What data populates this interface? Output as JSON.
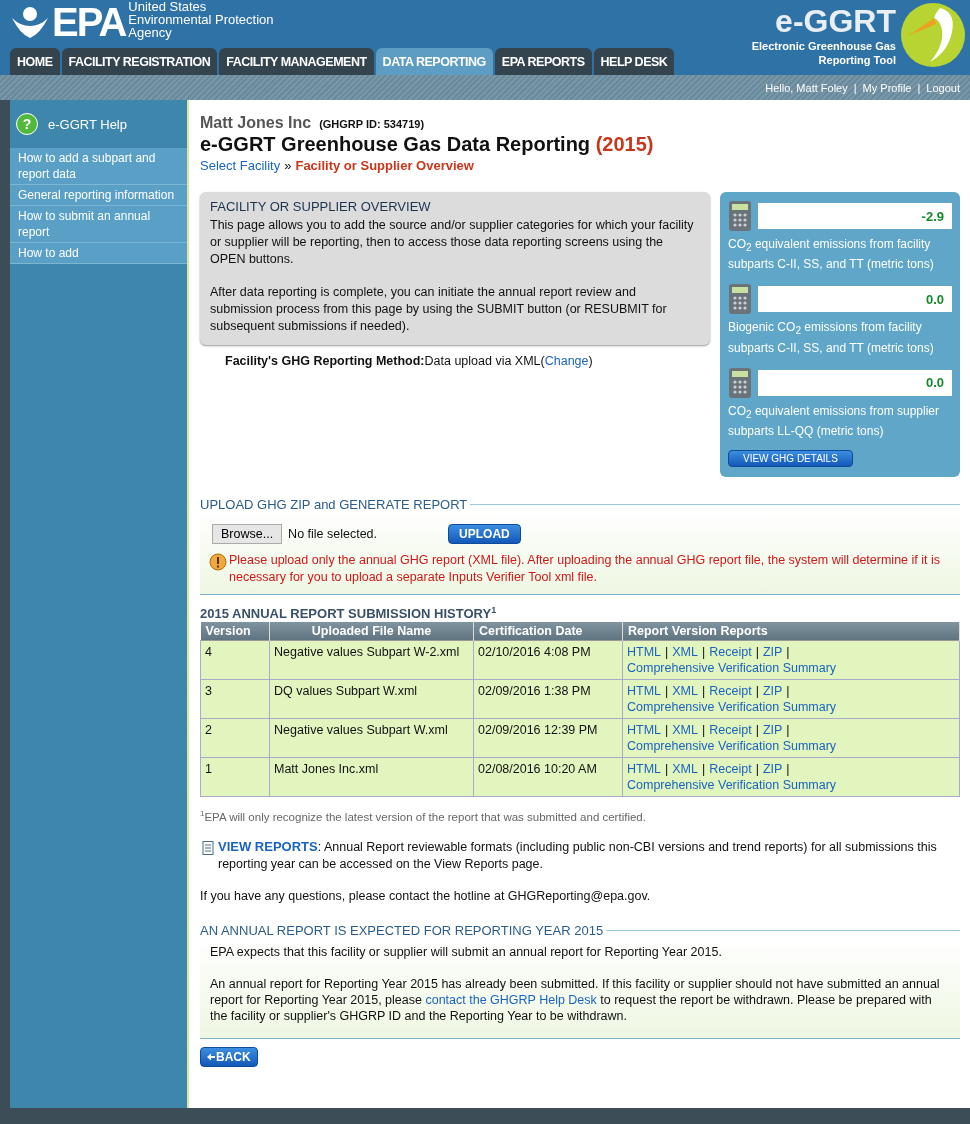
{
  "header": {
    "logo_text": "EPA",
    "agency_lines": [
      "United States",
      "Environmental Protection",
      "Agency"
    ],
    "app_logo": "e-GGRT",
    "app_subtitle_lines": [
      "Electronic Greenhouse Gas",
      "Reporting Tool"
    ]
  },
  "tabs": [
    {
      "label": "HOME",
      "selected": false
    },
    {
      "label": "FACILITY REGISTRATION",
      "selected": false
    },
    {
      "label": "FACILITY MANAGEMENT",
      "selected": false
    },
    {
      "label": "DATA REPORTING",
      "selected": true
    },
    {
      "label": "EPA REPORTS",
      "selected": false
    },
    {
      "label": "HELP DESK",
      "selected": false
    }
  ],
  "user_bar": {
    "greeting": "Hello, Matt Foley",
    "links": [
      "My Profile",
      "Logout"
    ],
    "separator": "|"
  },
  "sidebar": {
    "icon_glyph": "?",
    "title": "e-GGRT Help",
    "items": [
      "How to add a subpart and report data",
      "General reporting information",
      "How to submit an annual report",
      "How to add"
    ]
  },
  "page": {
    "company": "Matt Jones Inc",
    "ghgrp_id": "(GHGRP ID: 534719)",
    "title": "e-GGRT Greenhouse Gas Data Reporting",
    "year": "(2015)",
    "breadcrumb": {
      "link": "Select Facility",
      "separator": "»",
      "current": "Facility or Supplier Overview"
    }
  },
  "overview": {
    "heading": "FACILITY OR SUPPLIER OVERVIEW",
    "paragraphs": [
      "This page allows you to add the source and/or supplier categories for which your facility or supplier will be reporting, then to access those data reporting screens using the OPEN buttons.",
      "After data reporting is complete, you can initiate the annual report review and submission process from this page by using the SUBMIT button (or RESUBMIT for subsequent submissions if needed)."
    ]
  },
  "method": {
    "label": "Facility's GHG Reporting Method:",
    "value": "Data upload via XML",
    "open": "(",
    "link": "Change",
    "close": ")"
  },
  "emissions": {
    "items": [
      {
        "value": "-2.9",
        "label": "CO$_{2}$ equivalent emissions from facility subparts C-II, SS, and TT (metric tons)"
      },
      {
        "value": "0.0",
        "label": "Biogenic CO$_{2}$ emissions from facility subparts C-II, SS, and TT (metric tons)"
      },
      {
        "value": "0.0",
        "label": "CO$_{2}$ equivalent emissions from supplier subparts LL-QQ (metric tons)"
      }
    ],
    "button": "VIEW GHG DETAILS"
  },
  "upload": {
    "heading": "UPLOAD GHG ZIP and GENERATE REPORT",
    "browse": "Browse...",
    "file_status": "No file selected.",
    "button": "UPLOAD",
    "warning": "Please upload only the annual GHG report (XML file). After uploading the annual GHG report file, the system will determine if it is necessary for you to upload a separate Inputs Verifier Tool xml file."
  },
  "history": {
    "title": "2015 ANNUAL REPORT SUBMISSION HISTORY$^{1}$",
    "columns": [
      "Version",
      "Uploaded File Name",
      "Certification Date",
      "Report Version Reports"
    ],
    "separator": "|",
    "rows": [
      {
        "version": "4",
        "file": "Negative values Subpart W-2.xml",
        "date": "02/10/2016 4:08 PM",
        "links": [
          "HTML",
          "XML",
          "Receipt",
          "ZIP",
          "Comprehensive Verification Summary"
        ]
      },
      {
        "version": "3",
        "file": "DQ values Subpart W.xml",
        "date": "02/09/2016 1:38 PM",
        "links": [
          "HTML",
          "XML",
          "Receipt",
          "ZIP",
          "Comprehensive Verification Summary"
        ]
      },
      {
        "version": "2",
        "file": "Negative values Subpart W.xml",
        "date": "02/09/2016 12:39 PM",
        "links": [
          "HTML",
          "XML",
          "Receipt",
          "ZIP",
          "Comprehensive Verification Summary"
        ]
      },
      {
        "version": "1",
        "file": "Matt Jones Inc.xml",
        "date": "02/08/2016 10:20 AM",
        "links": [
          "HTML",
          "XML",
          "Receipt",
          "ZIP",
          "Comprehensive Verification Summary"
        ]
      }
    ],
    "footnote": "$^{1}$EPA will only recognize the latest version of the report that was submitted and certified."
  },
  "view_reports": {
    "link": "VIEW REPORTS",
    "text": ": Annual Report reviewable formats (including public non-CBI versions and trend reports) for all submissions this reporting year can be accessed on the View Reports page."
  },
  "contact": "If you have any questions, please contact the hotline at GHGReporting@epa.gov.",
  "annual": {
    "heading": "AN ANNUAL REPORT IS EXPECTED FOR REPORTING YEAR 2015",
    "p1": "EPA expects that this facility or supplier will submit an annual report for Reporting Year 2015.",
    "p2_before": "An annual report for Reporting Year 2015 has already been submitted. If this facility or supplier should not have submitted an annual report for Reporting Year 2015, please ",
    "p2_link": "contact the GHGRP Help Desk",
    "p2_after": " to request the report be withdrawn. Please be prepared with the facility or supplier's GHGRP ID and the Reporting Year to be withdrawn."
  },
  "back_button": "BACK"
}
